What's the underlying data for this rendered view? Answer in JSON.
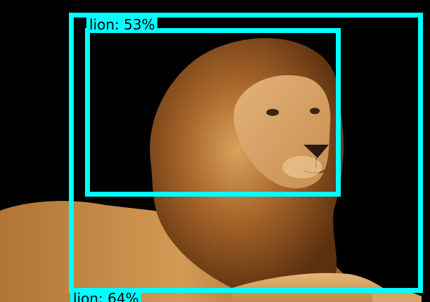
{
  "image": {
    "subject": "lion",
    "background_color": "#000000"
  },
  "box_color": "#00ffff",
  "detections": [
    {
      "label": "lion: 53%"
    },
    {
      "label": "lion: 64%"
    }
  ]
}
